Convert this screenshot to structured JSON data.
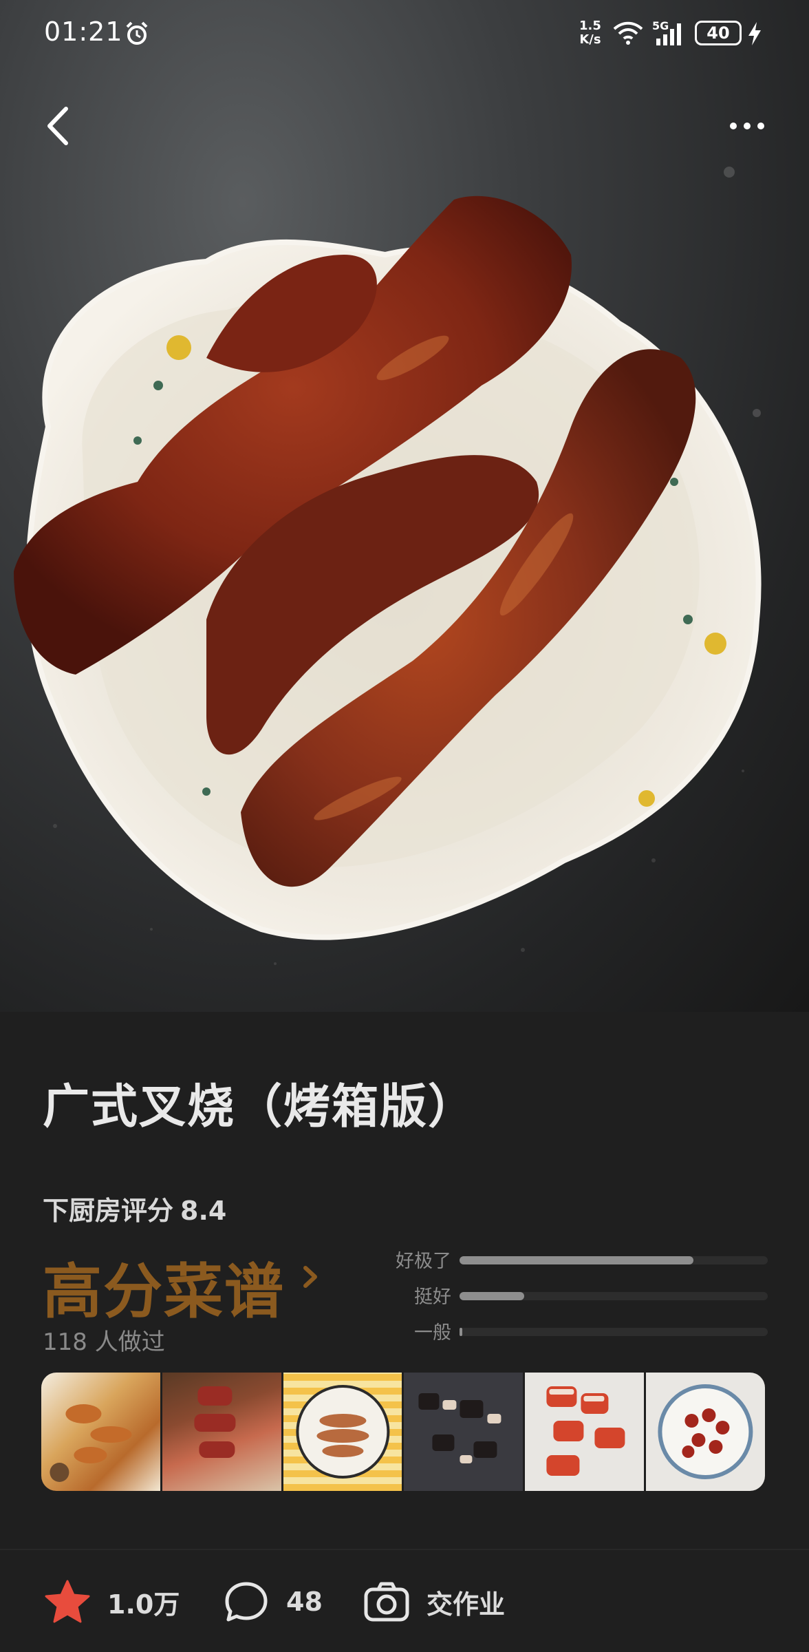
{
  "status_bar": {
    "time": "01:21",
    "net_speed_value": "1.5",
    "net_speed_unit": "K/s",
    "network_type": "5G",
    "battery": "40"
  },
  "header": {
    "back_icon": "chevron-left-icon",
    "more_icon": "more-horizontal-icon"
  },
  "recipe": {
    "title": "广式叉烧（烤箱版）",
    "score_label": "下厨房评分",
    "score_value": "8.4",
    "grade_label": "高分菜谱",
    "cooked_count": "118 人做过",
    "rating_breakdown": [
      {
        "label": "好极了",
        "fraction": 0.76
      },
      {
        "label": "挺好",
        "fraction": 0.21
      },
      {
        "label": "一般",
        "fraction": 0.01
      }
    ],
    "photo_thumbnails": [
      "dish-photo-1",
      "dish-photo-2",
      "dish-photo-3",
      "dish-photo-4",
      "dish-photo-5",
      "dish-photo-6"
    ]
  },
  "actions": {
    "favorite_count": "1.0万",
    "comment_count": "48",
    "homework_label": "交作业"
  },
  "colors": {
    "background": "#1f1f1f",
    "grade_accent": "#8b5a1f",
    "favorite_star": "#e84c3d"
  }
}
